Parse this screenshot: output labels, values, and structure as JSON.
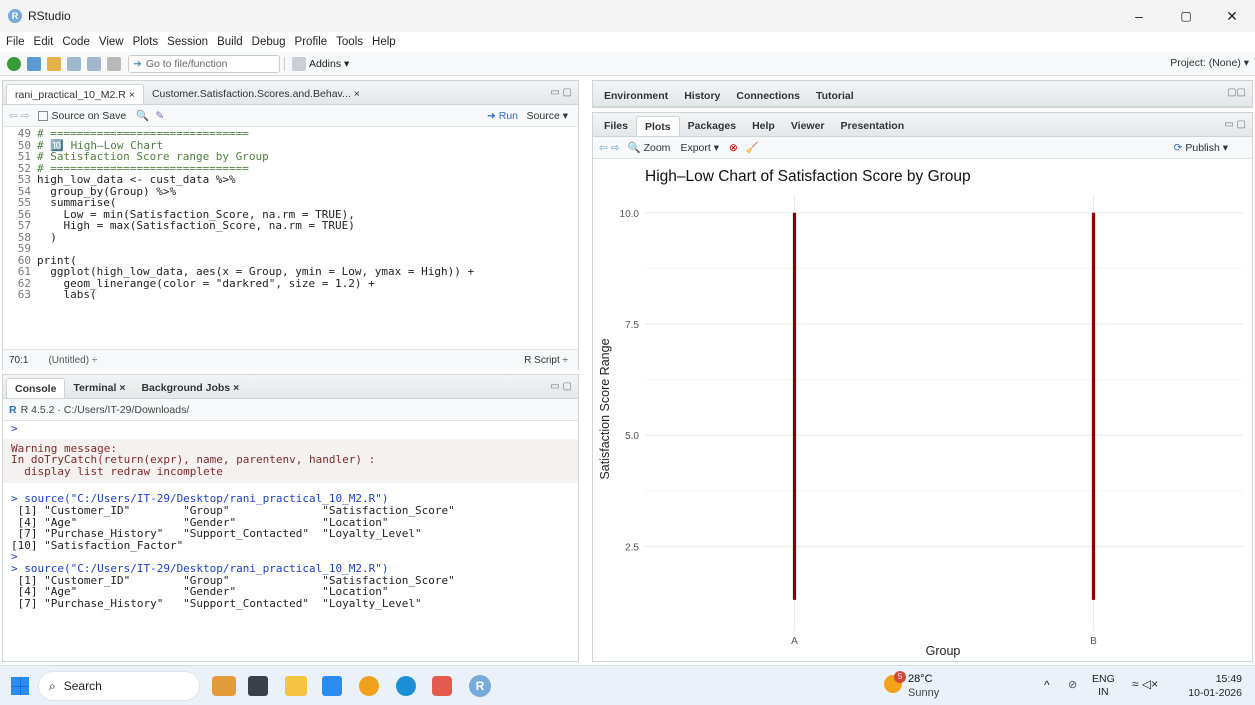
{
  "window": {
    "app_name": "RStudio",
    "logo_letter": "R",
    "min": "–",
    "max": "▢",
    "close": "✕"
  },
  "menu": [
    "File",
    "Edit",
    "Code",
    "View",
    "Plots",
    "Session",
    "Build",
    "Debug",
    "Profile",
    "Tools",
    "Help"
  ],
  "toolbar": {
    "goto_placeholder": "Go to file/function",
    "addins": "Addins ▾",
    "project": "Project: (None) ▾"
  },
  "editor": {
    "tabs": [
      "rani_practical_10_M2.R ×",
      "Customer.Satisfaction.Scores.and.Behav... ×"
    ],
    "source_on_save": "Source on Save",
    "run": "Run",
    "source": "Source ▾",
    "lines": [
      {
        "n": "49",
        "t": "# =============================="
      },
      {
        "n": "50",
        "t": "# 🔟 High–Low Chart"
      },
      {
        "n": "51",
        "t": "# Satisfaction Score range by Group"
      },
      {
        "n": "52",
        "t": "# =============================="
      },
      {
        "n": "53",
        "t": "high_low_data <- cust_data %>%"
      },
      {
        "n": "54",
        "t": "  group_by(Group) %>%"
      },
      {
        "n": "55",
        "t": "  summarise("
      },
      {
        "n": "56",
        "t": "    Low = min(Satisfaction_Score, na.rm = TRUE),"
      },
      {
        "n": "57",
        "t": "    High = max(Satisfaction_Score, na.rm = TRUE)"
      },
      {
        "n": "58",
        "t": "  )"
      },
      {
        "n": "59",
        "t": ""
      },
      {
        "n": "60",
        "t": "print("
      },
      {
        "n": "61",
        "t": "  ggplot(high_low_data, aes(x = Group, ymin = Low, ymax = High)) +"
      },
      {
        "n": "62",
        "t": "    geom_linerange(color = \"darkred\", size = 1.2) +"
      },
      {
        "n": "63",
        "t": "    labs("
      }
    ],
    "status_pos": "70:1",
    "status_scope": "(Untitled) ÷",
    "status_type": "R Script ÷"
  },
  "console": {
    "tabs": [
      "Console",
      "Terminal ×",
      "Background Jobs ×"
    ],
    "path": "R 4.5.2 · C:/Users/IT-29/Downloads/",
    "prompt": ">",
    "warning": [
      "Warning message:",
      "In doTryCatch(return(expr), name, parentenv, handler) :",
      "  display list redraw incomplete"
    ],
    "lines1": [
      "> source(\"C:/Users/IT-29/Desktop/rani_practical_10_M2.R\")",
      " [1] \"Customer_ID\"        \"Group\"              \"Satisfaction_Score\"",
      " [4] \"Age\"                \"Gender\"             \"Location\"",
      " [7] \"Purchase_History\"   \"Support_Contacted\"  \"Loyalty_Level\"",
      "[10] \"Satisfaction_Factor\"",
      ">",
      "> source(\"C:/Users/IT-29/Desktop/rani_practical_10_M2.R\")",
      " [1] \"Customer_ID\"        \"Group\"              \"Satisfaction_Score\"",
      " [4] \"Age\"                \"Gender\"             \"Location\"",
      " [7] \"Purchase_History\"   \"Support_Contacted\"  \"Loyalty_Level\""
    ]
  },
  "env_tabs": [
    "Environment",
    "History",
    "Connections",
    "Tutorial"
  ],
  "files_tabs": [
    "Files",
    "Plots",
    "Packages",
    "Help",
    "Viewer",
    "Presentation"
  ],
  "plots_toolbar": {
    "zoom": "Zoom",
    "export": "Export ▾",
    "publish": "Publish ▾"
  },
  "chart_data": {
    "type": "high-low",
    "title": "High–Low Chart of Satisfaction Score by Group",
    "xlabel": "Group",
    "ylabel": "Satisfaction Score Range",
    "categories": [
      "A",
      "B"
    ],
    "low": [
      1.3,
      1.3
    ],
    "high": [
      10.0,
      10.0
    ],
    "ylim": [
      0.6,
      10.4
    ],
    "yticks": [
      "2.5",
      "5.0",
      "7.5",
      "10.0"
    ],
    "ytick_values": [
      2.5,
      5.0,
      7.5,
      10.0
    ],
    "line_color": "#8b0000"
  },
  "taskbar": {
    "search": "Search",
    "weather_temp": "28°C",
    "weather_desc": "Sunny",
    "weather_badge": "5",
    "lang1": "ENG",
    "lang2": "IN",
    "time": "15:49",
    "date": "10-01-2026"
  }
}
